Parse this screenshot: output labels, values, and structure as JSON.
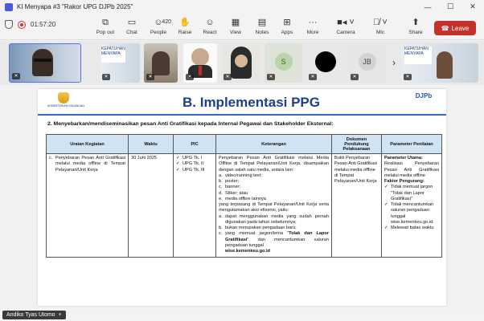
{
  "window": {
    "title": "KI Menyapa #3 \"Rakor UPG DJPb 2025\"",
    "controls": [
      "—",
      "☐",
      "✕"
    ]
  },
  "toolbar": {
    "timer": "01:57:20",
    "items": [
      {
        "id": "popout",
        "label": "Pop out",
        "icon": "popout-icon"
      },
      {
        "id": "chat",
        "label": "Chat",
        "icon": "chat-icon"
      },
      {
        "id": "people",
        "label": "People",
        "icon": "people-icon",
        "count": "420"
      },
      {
        "id": "raise",
        "label": "Raise",
        "icon": "raise-hand-icon"
      },
      {
        "id": "react",
        "label": "React",
        "icon": "smiley-icon"
      },
      {
        "id": "view",
        "label": "View",
        "icon": "view-grid-icon"
      },
      {
        "id": "notes",
        "label": "Notes",
        "icon": "notes-icon"
      },
      {
        "id": "apps",
        "label": "Apps",
        "icon": "apps-plus-icon"
      },
      {
        "id": "more",
        "label": "More",
        "icon": "more-dots-icon"
      },
      {
        "id": "camera",
        "label": "Camera",
        "icon": "camera-icon"
      },
      {
        "id": "mic",
        "label": "Mic",
        "icon": "mic-icon"
      },
      {
        "id": "share",
        "label": "Share",
        "icon": "share-icon"
      }
    ],
    "leave_label": "Leave"
  },
  "participants": [
    {
      "initials": ""
    },
    {
      "initials": ""
    },
    {
      "initials": ""
    },
    {
      "initials": ""
    },
    {
      "initials": ""
    },
    {
      "initials": "S"
    },
    {
      "initials": ""
    },
    {
      "initials": "JB"
    },
    {
      "initials": ""
    }
  ],
  "slide": {
    "logo_left_caption": "KEMENTERIAN KEUANGAN",
    "logo_right_text": "DJPb",
    "title": "B. Implementasi PPG",
    "section_heading": "2. Menyebarkan/mendiseminasikan pesan Anti Gratifikasi kepada Internal Pegawai dan Stakeholder Eksternal:",
    "table": {
      "headers": [
        "Uraian Kegiatan",
        "Waktu",
        "PIC",
        "Keterangan",
        "Dokumen Pendukung Pelaksanaan",
        "Parameter Penilaian"
      ],
      "row": {
        "no": "c.",
        "uraian": "Penyebaran Pesan Anti Gratifikasi melalui media offline di Tempat Pelayanan/Unit Kerja",
        "waktu": "30 Juni 2025",
        "pic": [
          "UPG Tk. I",
          "UPG Tk. II",
          "UPG Tk. III"
        ],
        "ket_intro": "Penyebaran Pesan Anti Gratifikasi melalui Media Offline di Tempat Pelayanan/Unit Kerja, disampaikan dengan salah satu media, antara lain:",
        "ket_list": [
          {
            "m": "a.",
            "t": "video/running text;"
          },
          {
            "m": "b.",
            "t": "poster;"
          },
          {
            "m": "c.",
            "t": "banner;"
          },
          {
            "m": "d.",
            "t": "Stiker; atau"
          },
          {
            "m": "e.",
            "t": "media offline lainnya"
          }
        ],
        "ket_mid": "yang terpasang di Tempat Pelayanan/Unit Kerja serta mengutamakan aksi efisensi, yaitu:",
        "ket_list2": [
          {
            "m": "a.",
            "t": "dapat menggunakan media yang sudah pernah digunakan pada tahun sebelumnya;"
          },
          {
            "m": "b.",
            "t": "bukan merupakan pengadaan baru;"
          }
        ],
        "ket_c_marker": "c.",
        "ket_c_pre": "yang memuat jargon/tema \"",
        "ket_c_bold": "Tolak dan Lapor Gratifikasi",
        "ket_c_post": "\" dan mencantumkan saluran pengaduan tunggal",
        "ket_url": "wise.kemenkeu.go.id",
        "dokumen": "Bukti Penyebaran Pesan Anti Gratifikasi melalui media offline di Tempat Pelayanan/Unit Kerja",
        "param_utama_label": "Parameter Utama:",
        "param_utama": "Realisasi Penyebaran Pesan Anti Gratifikasi melalui media offline",
        "param_pengurang_label": "Faktor Pengurang:",
        "param_pengurang": [
          "Tidak memuat jargon \"Tolak dan Lapor Gratifikasi\"",
          "Tidak mencantumkan saluran pengaduan tunggal wise.kemenkeu.go.id",
          "Melewati batas waktu"
        ]
      }
    }
  },
  "presenter": {
    "name": "Andiko Tyas Utomo"
  },
  "colors": {
    "leave": "#c4312b",
    "slide_title": "#1e3f8c",
    "table_header": "#cfe3f3",
    "accent_line": "#2b6ad0"
  }
}
